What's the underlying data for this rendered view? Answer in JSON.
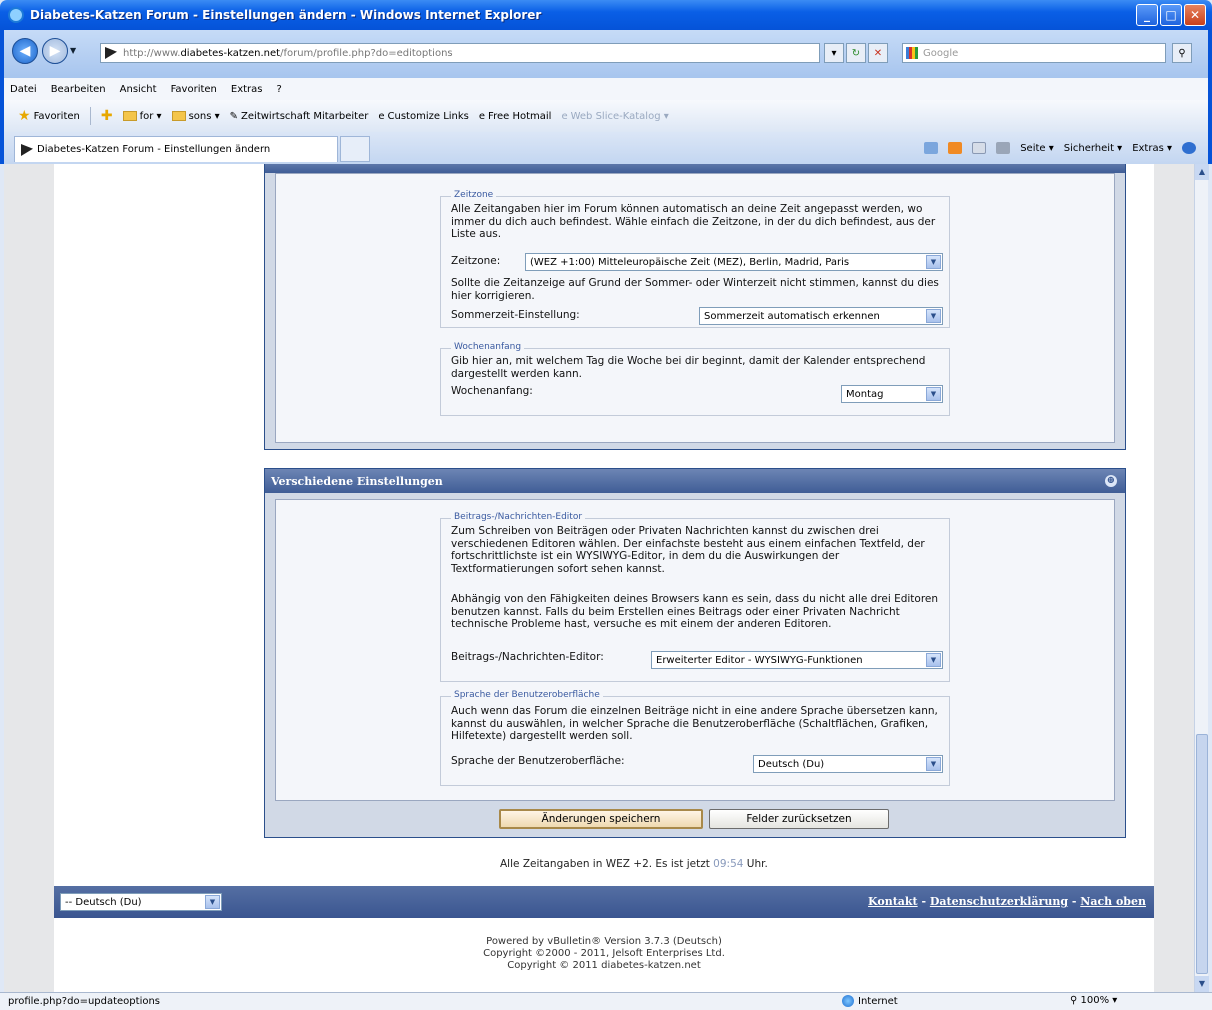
{
  "window": {
    "title": "Diabetes-Katzen Forum - Einstellungen ändern - Windows Internet Explorer",
    "min": "_",
    "max": "□",
    "close": "✕"
  },
  "address": {
    "url_prefix": "http://www.",
    "url_domain": "diabetes-katzen.net",
    "url_path": "/forum/profile.php?do=editoptions",
    "search_placeholder": "Google"
  },
  "menu": [
    "Datei",
    "Bearbeiten",
    "Ansicht",
    "Favoriten",
    "Extras",
    "?"
  ],
  "favorites": {
    "label": "Favoriten",
    "items": [
      "for ▾",
      "sons ▾",
      "Zeitwirtschaft Mitarbeiter",
      "Customize Links",
      "Free Hotmail",
      "Web Slice-Katalog ▾"
    ]
  },
  "tab": {
    "title": "Diabetes-Katzen Forum - Einstellungen ändern"
  },
  "commands": [
    "Seite ▾",
    "Sicherheit ▾",
    "Extras ▾"
  ],
  "panel1": {
    "zeitzone": {
      "legend": "Zeitzone",
      "desc": "Alle Zeitangaben hier im Forum können automatisch an deine Zeit angepasst werden, wo immer du dich auch befindest. Wähle einfach die Zeitzone, in der du dich befindest, aus der Liste aus.",
      "label": "Zeitzone:",
      "value": "(WEZ +1:00) Mitteleuropäische Zeit (MEZ), Berlin, Madrid, Paris",
      "dst_desc": "Sollte die Zeitanzeige auf Grund der Sommer- oder Winterzeit nicht stimmen, kannst du dies hier korrigieren.",
      "dst_label": "Sommerzeit-Einstellung:",
      "dst_value": "Sommerzeit automatisch erkennen"
    },
    "wochenanfang": {
      "legend": "Wochenanfang",
      "desc": "Gib hier an, mit welchem Tag die Woche bei dir beginnt, damit der Kalender entsprechend dargestellt werden kann.",
      "label": "Wochenanfang:",
      "value": "Montag"
    }
  },
  "panel2": {
    "title": "Verschiedene Einstellungen",
    "editor": {
      "legend": "Beitrags-/Nachrichten-Editor",
      "desc1": "Zum Schreiben von Beiträgen oder Privaten Nachrichten kannst du zwischen drei verschiedenen Editoren wählen. Der einfachste besteht aus einem einfachen Textfeld, der fortschrittlichste ist ein WYSIWYG-Editor, in dem du die Auswirkungen der Textformatierungen sofort sehen kannst.",
      "desc2": "Abhängig von den Fähigkeiten deines Browsers kann es sein, dass du nicht alle drei Editoren benutzen kannst. Falls du beim Erstellen eines Beitrags oder einer Privaten Nachricht technische Probleme hast, versuche es mit einem der anderen Editoren.",
      "label": "Beitrags-/Nachrichten-Editor:",
      "value": "Erweiterter Editor - WYSIWYG-Funktionen"
    },
    "sprache": {
      "legend": "Sprache der Benutzeroberfläche",
      "desc": "Auch wenn das Forum die einzelnen Beiträge nicht in eine andere Sprache übersetzen kann, kannst du auswählen, in welcher Sprache die Benutzeroberfläche (Schaltflächen, Grafiken, Hilfetexte) dargestellt werden soll.",
      "label": "Sprache der Benutzeroberfläche:",
      "value": "Deutsch (Du)"
    }
  },
  "buttons": {
    "save": "Änderungen speichern",
    "reset": "Felder zurücksetzen"
  },
  "timeinfo": {
    "prefix": "Alle Zeitangaben in WEZ +2. Es ist jetzt ",
    "time": "09:54",
    "suffix": " Uhr."
  },
  "footer": {
    "language": "-- Deutsch (Du)",
    "links": [
      "Kontakt",
      "Datenschutzerklärung",
      "Nach oben"
    ],
    "powered": "Powered by vBulletin® Version 3.7.3 (Deutsch)",
    "copyright1": "Copyright ©2000 - 2011, Jelsoft Enterprises Ltd.",
    "copyright2": "Copyright © 2011 diabetes-katzen.net"
  },
  "status": {
    "url": "profile.php?do=updateoptions",
    "zone": "Internet",
    "zoom": "100%"
  }
}
